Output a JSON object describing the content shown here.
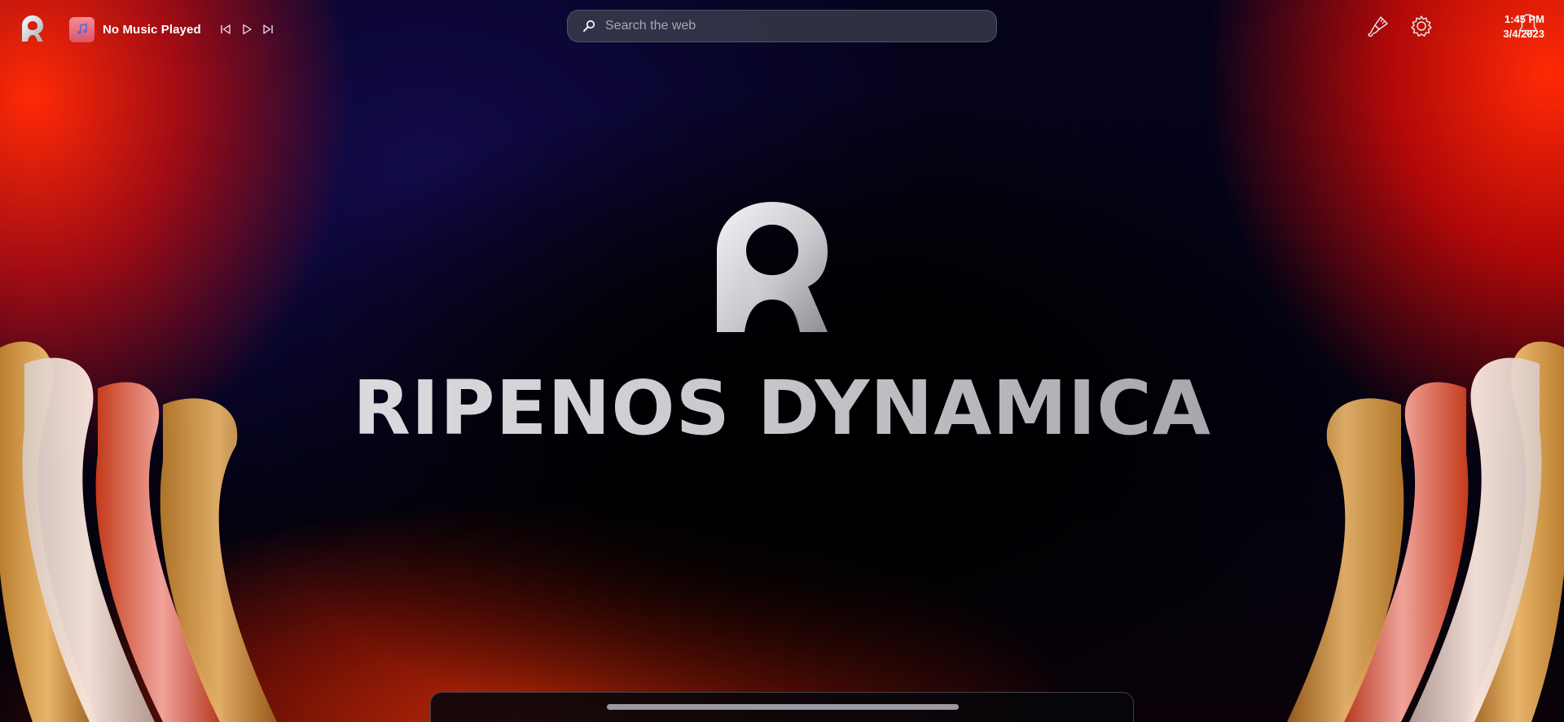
{
  "topbar": {
    "app_logo_icon": "ripenos-logo-icon",
    "music": {
      "title": "No Music Played",
      "album_icon": "music-note-icon",
      "controls": [
        "previous-track-icon",
        "play-icon",
        "next-track-icon"
      ]
    },
    "search": {
      "placeholder": "Search the web",
      "value": "",
      "icon": "search-icon"
    },
    "right": {
      "brush_icon": "paintbrush-icon",
      "gear_icon": "gear-icon",
      "time": "1:45 PM",
      "date": "3/4/2023",
      "bell_icon": "bell-icon"
    }
  },
  "splash": {
    "logo_icon": "ripenos-logo-icon",
    "brand": "RIPENOS DYNAMICA"
  },
  "dock": {
    "handle": "dock-handle"
  },
  "colors": {
    "accent_red": "#ff2a05",
    "background_dark": "#020212",
    "album_pink": "#e56a7c"
  }
}
